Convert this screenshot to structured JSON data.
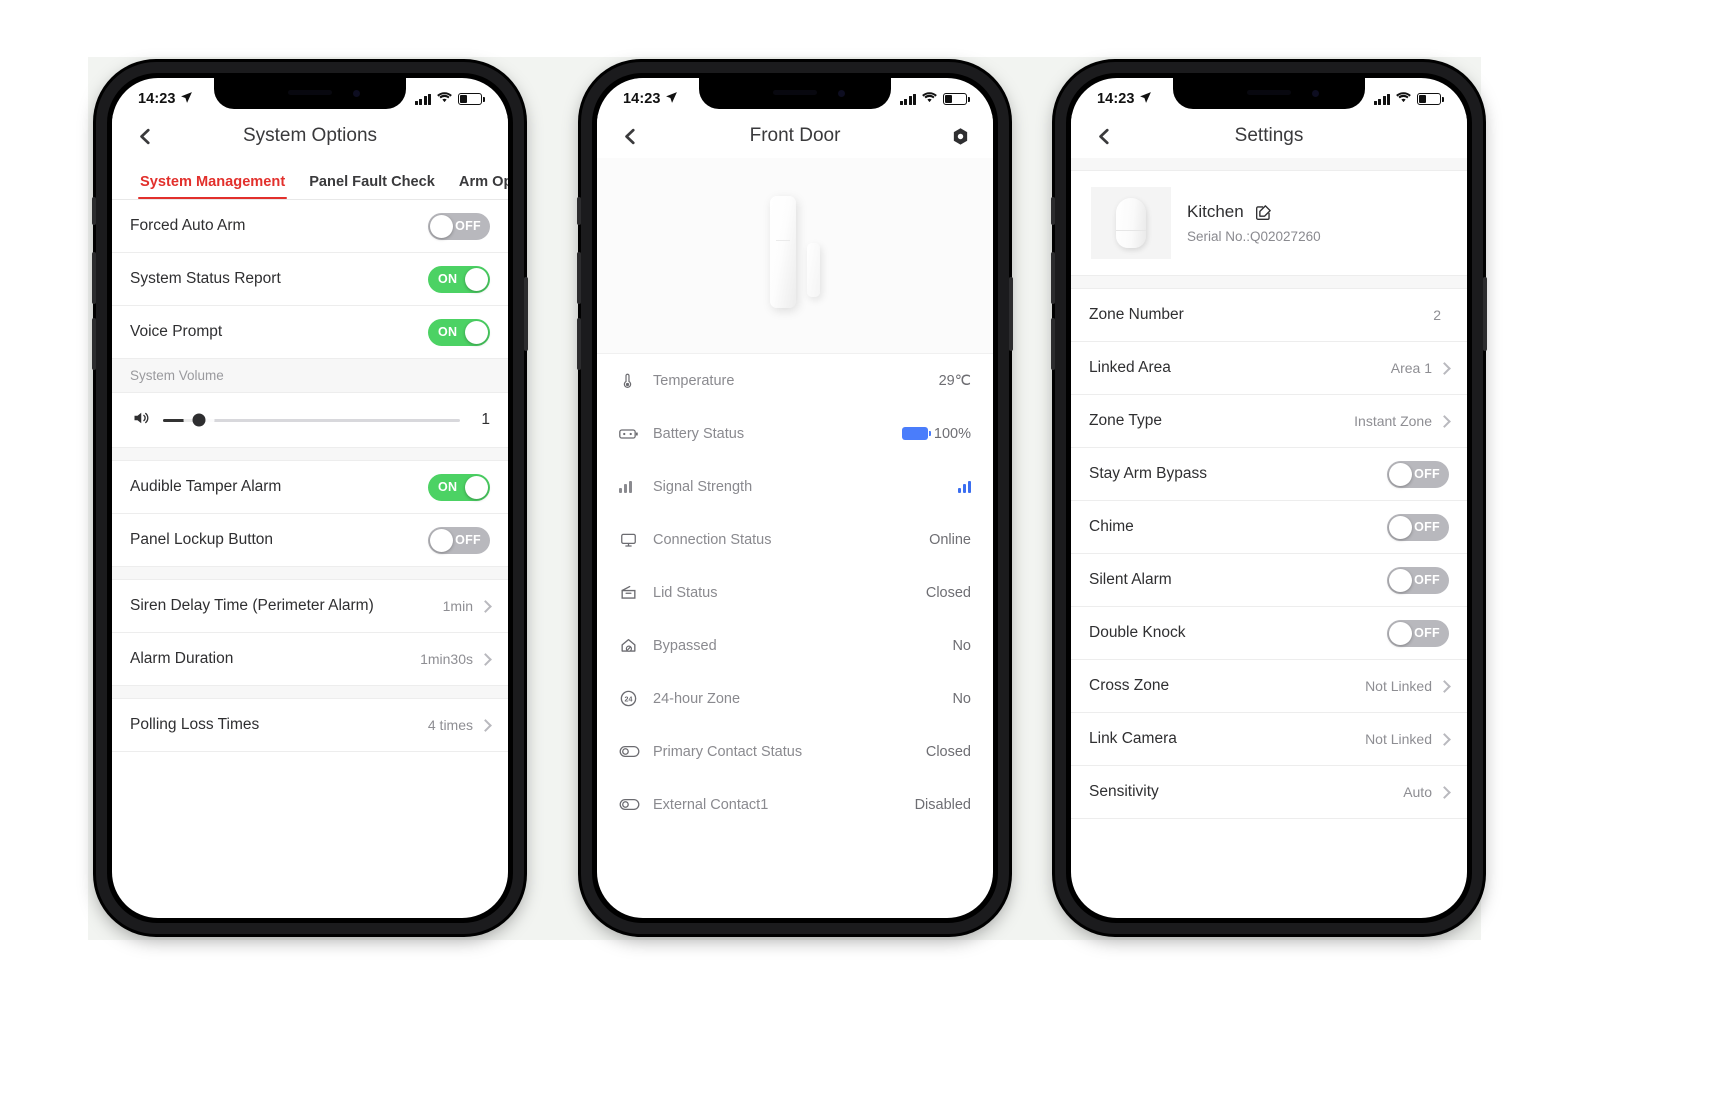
{
  "status_bar": {
    "time": "14:23"
  },
  "phone1": {
    "nav": {
      "title": "System Options",
      "back_icon": "back-chevron-icon"
    },
    "tabs": [
      {
        "label": "System Management",
        "active": true
      },
      {
        "label": "Panel Fault Check",
        "active": false
      },
      {
        "label": "Arm Opti",
        "active": false
      }
    ],
    "rows": [
      {
        "label": "Forced Auto Arm",
        "toggle": "OFF"
      },
      {
        "label": "System Status Report",
        "toggle": "ON"
      },
      {
        "label": "Voice Prompt",
        "toggle": "ON"
      }
    ],
    "volume": {
      "section_label": "System Volume",
      "value": "1",
      "percent": 12,
      "speaker_icon": "speaker-icon"
    },
    "rows2": [
      {
        "label": "Audible Tamper Alarm",
        "toggle": "ON"
      },
      {
        "label": "Panel Lockup Button",
        "toggle": "OFF"
      }
    ],
    "rows3": [
      {
        "label": "Siren Delay Time (Perimeter Alarm)",
        "value": "1min"
      },
      {
        "label": "Alarm Duration",
        "value": "1min30s"
      }
    ],
    "rows4": [
      {
        "label": "Polling Loss Times",
        "value": "4 times"
      }
    ]
  },
  "phone2": {
    "nav": {
      "title": "Front Door",
      "back_icon": "back-chevron-icon",
      "right_icon": "settings-gear-icon"
    },
    "hero": {
      "image": "door-contact-sensor-illustration"
    },
    "details": [
      {
        "icon": "thermometer-icon",
        "label": "Temperature",
        "value": "29℃"
      },
      {
        "icon": "battery-icon",
        "label": "Battery Status",
        "value": "100%"
      },
      {
        "icon": "signal-bars-icon",
        "label": "Signal Strength",
        "value": ""
      },
      {
        "icon": "monitor-icon",
        "label": "Connection Status",
        "value": "Online"
      },
      {
        "icon": "lid-icon",
        "label": "Lid Status",
        "value": "Closed"
      },
      {
        "icon": "house-bypass-icon",
        "label": "Bypassed",
        "value": "No"
      },
      {
        "icon": "24-hour-icon",
        "label": "24-hour Zone",
        "value": "No"
      },
      {
        "icon": "contact-switch-icon",
        "label": "Primary Contact Status",
        "value": "Closed"
      },
      {
        "icon": "contact-switch-icon",
        "label": "External Contact1",
        "value": "Disabled"
      }
    ]
  },
  "phone3": {
    "nav": {
      "title": "Settings",
      "back_icon": "back-chevron-icon"
    },
    "device": {
      "name": "Kitchen",
      "serial_label": "Serial No.:Q02027260",
      "edit_icon": "edit-pencil-icon",
      "thumb": "pir-detector-thumbnail"
    },
    "rows": [
      {
        "label": "Zone Number",
        "value": "2",
        "type": "text"
      },
      {
        "label": "Linked Area",
        "value": "Area 1",
        "type": "link"
      },
      {
        "label": "Zone Type",
        "value": "Instant Zone",
        "type": "link"
      },
      {
        "label": "Stay Arm Bypass",
        "value": "OFF",
        "type": "toggle"
      },
      {
        "label": "Chime",
        "value": "OFF",
        "type": "toggle"
      },
      {
        "label": "Silent Alarm",
        "value": "OFF",
        "type": "toggle"
      },
      {
        "label": "Double Knock",
        "value": "OFF",
        "type": "toggle"
      },
      {
        "label": "Cross Zone",
        "value": "Not Linked",
        "type": "link"
      },
      {
        "label": "Link Camera",
        "value": "Not Linked",
        "type": "link"
      },
      {
        "label": "Sensitivity",
        "value": "Auto",
        "type": "link"
      }
    ]
  },
  "colors": {
    "accent_red": "#e2302c",
    "toggle_on": "#4cd264",
    "toggle_off": "#b8b8bd",
    "battery_blue": "#4a7dfb"
  }
}
